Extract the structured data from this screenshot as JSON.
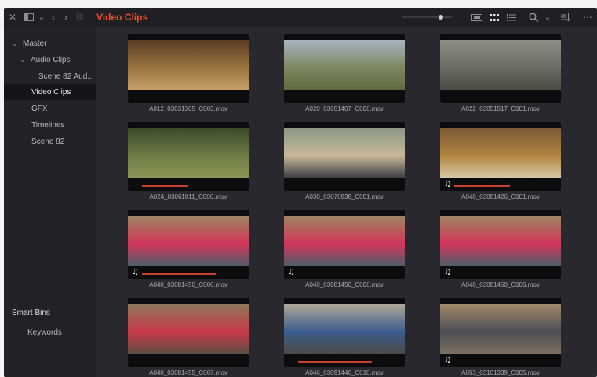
{
  "toolbar": {
    "title": "Video Clips",
    "icons": [
      "close-icon",
      "panel-layout-icon",
      "chevron-down-icon",
      "back-icon",
      "forward-icon",
      "link-icon",
      "slider-icon",
      "filmstrip-view-icon",
      "thumbnail-view-icon",
      "list-view-icon",
      "search-icon",
      "chevron-down-icon",
      "sort-icon",
      "more-icon"
    ],
    "zoom_level": 0.82
  },
  "sidebar": {
    "bins": [
      {
        "label": "Master",
        "expander": "⌄"
      },
      {
        "label": "Audio Clips",
        "expander": "⌄"
      },
      {
        "label": "Scene 82 Aud..."
      },
      {
        "label": "Video Clips"
      },
      {
        "label": "GFX"
      },
      {
        "label": "Timelines"
      },
      {
        "label": "Scene 82"
      }
    ],
    "smart_bins_label": "Smart Bins",
    "smart_bins": [
      {
        "label": "Keywords"
      }
    ]
  },
  "clips": [
    {
      "name": "A012_03031305_C003.mov",
      "colors": [
        "#5a3c22",
        "#9a7440",
        "#c9a06a"
      ],
      "audio": false,
      "bar": 0
    },
    {
      "name": "A020_03051407_C006.mov",
      "colors": [
        "#a9b5c0",
        "#7c8760",
        "#5e6b3e"
      ],
      "audio": false,
      "bar": 0
    },
    {
      "name": "A022_03051517_C001.mov",
      "colors": [
        "#8f8f86",
        "#6b6b62",
        "#4b4b45"
      ],
      "audio": false,
      "bar": 0
    },
    {
      "name": "A024_03061011_C006.mov",
      "colors": [
        "#3c4a2c",
        "#6e7d46",
        "#8a9656"
      ],
      "audio": false,
      "bar": 0.5
    },
    {
      "name": "A030_03070838_C001.mov",
      "colors": [
        "#8b9a86",
        "#c9b79b",
        "#3a3b3f"
      ],
      "audio": false,
      "bar": 0
    },
    {
      "name": "A040_03081426_C001.mov",
      "colors": [
        "#7b5a36",
        "#b0843f",
        "#d8c9a8"
      ],
      "audio": true,
      "bar": 0.6
    },
    {
      "name": "A040_03081450_C006.mov",
      "colors": [
        "#9d8462",
        "#d2355a",
        "#4b5e6b"
      ],
      "audio": true,
      "bar": 0.8
    },
    {
      "name": "A040_03081450_C006.mov",
      "colors": [
        "#9d8462",
        "#d2355a",
        "#4b5e6b"
      ],
      "audio": true,
      "bar": 0
    },
    {
      "name": "A040_03081450_C006.mov",
      "colors": [
        "#9d8462",
        "#d2355a",
        "#4b5e6b"
      ],
      "audio": true,
      "bar": 0
    },
    {
      "name": "A040_03081455_C007.mov",
      "colors": [
        "#8e7a5c",
        "#c93a4c",
        "#5a4d43"
      ],
      "audio": false,
      "bar": 0
    },
    {
      "name": "A046_03091446_C010.mov",
      "colors": [
        "#b0a898",
        "#3c5c8c",
        "#4c4a48"
      ],
      "audio": false,
      "bar": 0.8
    },
    {
      "name": "A053_03101339_C005.mov",
      "colors": [
        "#a08a6a",
        "#4e4e55",
        "#7f6f60"
      ],
      "audio": true,
      "bar": 0
    }
  ]
}
